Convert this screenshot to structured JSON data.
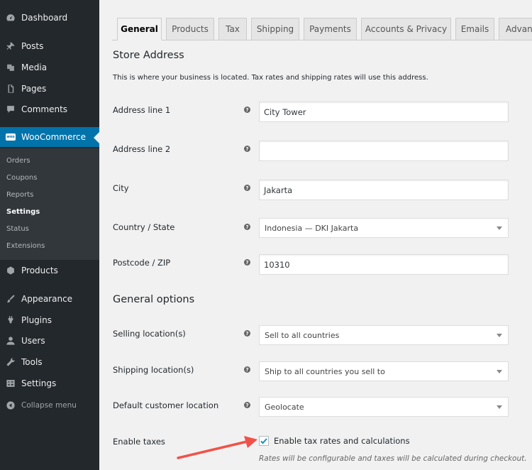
{
  "sidebar": {
    "items": [
      {
        "label": "Dashboard",
        "icon": "dashboard-icon"
      },
      {
        "label": "Posts",
        "icon": "pin-icon"
      },
      {
        "label": "Media",
        "icon": "media-icon"
      },
      {
        "label": "Pages",
        "icon": "pages-icon"
      },
      {
        "label": "Comments",
        "icon": "comment-icon"
      },
      {
        "label": "WooCommerce",
        "icon": "woocommerce-icon",
        "active": true
      },
      {
        "label": "Products",
        "icon": "box-icon"
      },
      {
        "label": "Appearance",
        "icon": "brush-icon"
      },
      {
        "label": "Plugins",
        "icon": "plug-icon"
      },
      {
        "label": "Users",
        "icon": "user-icon"
      },
      {
        "label": "Tools",
        "icon": "wrench-icon"
      },
      {
        "label": "Settings",
        "icon": "settings-icon"
      }
    ],
    "woo_badge": "woo",
    "submenu": [
      "Orders",
      "Coupons",
      "Reports",
      "Settings",
      "Status",
      "Extensions"
    ],
    "submenu_current": "Settings",
    "collapse": "Collapse menu"
  },
  "tabs": [
    "General",
    "Products",
    "Tax",
    "Shipping",
    "Payments",
    "Accounts & Privacy",
    "Emails",
    "Advanced"
  ],
  "active_tab": "General",
  "store_address": {
    "heading": "Store Address",
    "description": "This is where your business is located. Tax rates and shipping rates will use this address.",
    "fields": [
      {
        "label": "Address line 1",
        "value": "City Tower"
      },
      {
        "label": "Address line 2",
        "value": ""
      },
      {
        "label": "City",
        "value": "Jakarta"
      },
      {
        "label": "Country / State",
        "value": "Indonesia — DKI Jakarta"
      },
      {
        "label": "Postcode / ZIP",
        "value": "10310"
      }
    ]
  },
  "general_options": {
    "heading": "General options",
    "fields": [
      {
        "label": "Selling location(s)",
        "value": "Sell to all countries"
      },
      {
        "label": "Shipping location(s)",
        "value": "Ship to all countries you sell to"
      },
      {
        "label": "Default customer location",
        "value": "Geolocate"
      }
    ],
    "taxes": {
      "label": "Enable taxes",
      "checkbox_label": "Enable tax rates and calculations",
      "checked": true,
      "note": "Rates will be configurable and taxes will be calculated during checkout."
    }
  },
  "help_glyph": "?",
  "colors": {
    "sidebar_bg": "#23282d",
    "active_blue": "#0073aa",
    "arrow_red": "#f0524a"
  }
}
